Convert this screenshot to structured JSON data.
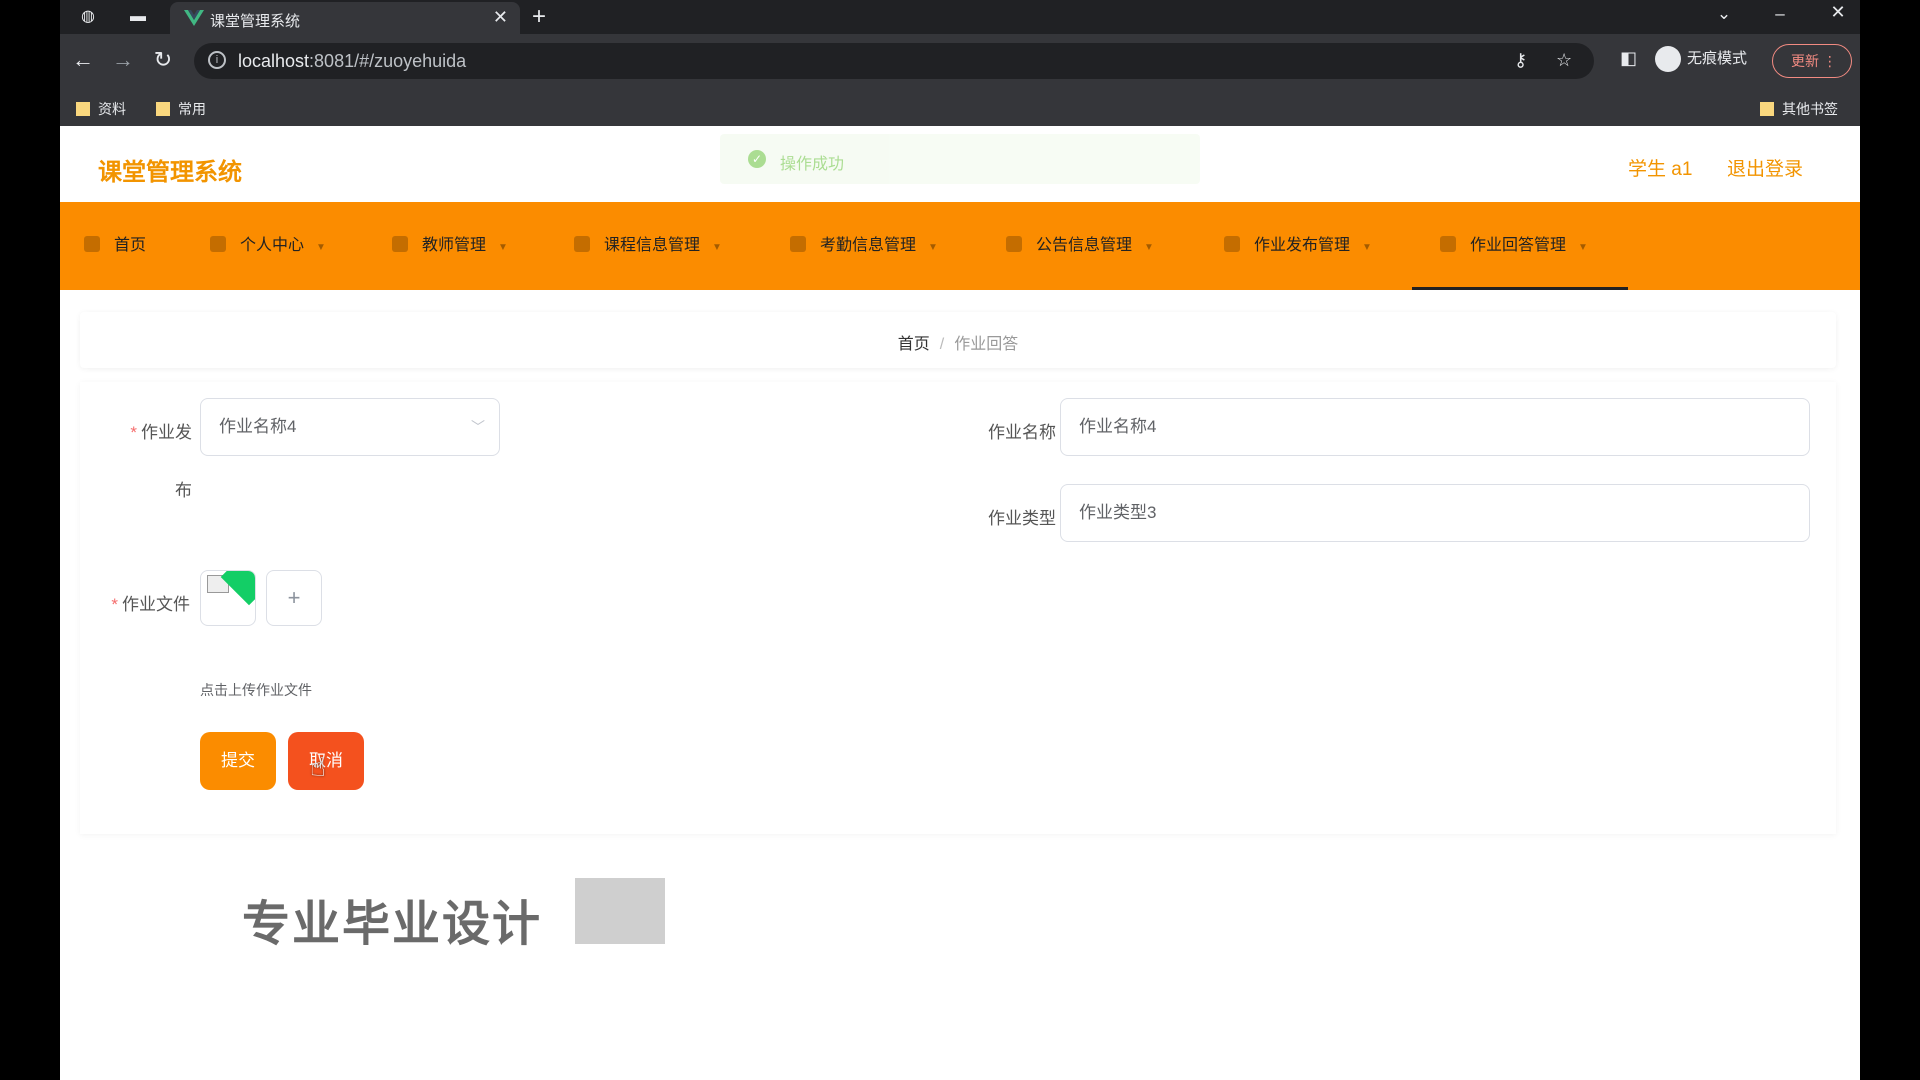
{
  "browser": {
    "tab_title": "课堂管理系统",
    "url_host": "localhost",
    "url_rest": ":8081/#/zuoyehuida",
    "incognito_label": "无痕模式",
    "update_label": "更新",
    "bookmarks": [
      "资料",
      "常用"
    ],
    "other_bookmarks": "其他书签"
  },
  "header": {
    "brand": "课堂管理系统",
    "toast": "操作成功",
    "user": "学生 a1",
    "logout": "退出登录"
  },
  "nav": {
    "items": [
      {
        "label": "首页"
      },
      {
        "label": "个人中心"
      },
      {
        "label": "教师管理"
      },
      {
        "label": "课程信息管理"
      },
      {
        "label": "考勤信息管理"
      },
      {
        "label": "公告信息管理"
      },
      {
        "label": "作业发布管理"
      },
      {
        "label": "作业回答管理"
      }
    ],
    "active_index": 7
  },
  "breadcrumb": {
    "home": "首页",
    "separator": "/",
    "current": "作业回答"
  },
  "form": {
    "assignment_label_1": "作业发",
    "assignment_label_2": "布",
    "assignment_value": "作业名称4",
    "name_label": "作业名称",
    "name_value": "作业名称4",
    "type_label": "作业类型",
    "type_value": "作业类型3",
    "file_label": "作业文件",
    "file_hint": "点击上传作业文件",
    "submit": "提交",
    "cancel": "取消"
  },
  "overlay": {
    "watermark": "专业毕业设计"
  }
}
